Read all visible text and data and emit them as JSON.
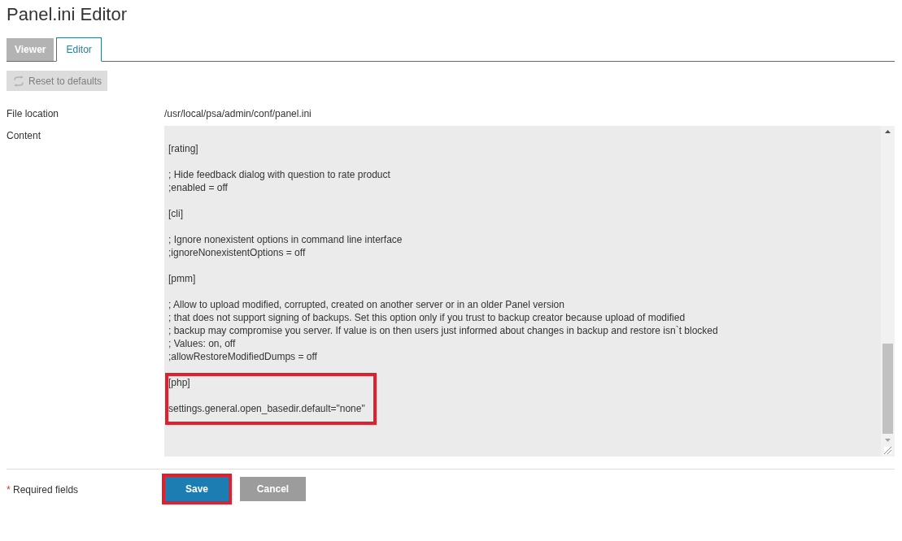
{
  "page": {
    "title": "Panel.ini Editor"
  },
  "tabs": [
    {
      "label": "Viewer",
      "selected": false
    },
    {
      "label": "Editor",
      "selected": true
    }
  ],
  "toolbar": {
    "buttons": [
      {
        "label": "Reset to defaults",
        "disabled": true
      }
    ]
  },
  "form": {
    "fields": [
      {
        "kind": "text",
        "label": "File location",
        "value": "/usr/local/psa/admin/conf/panel.ini"
      },
      {
        "kind": "textarea",
        "label": "Content",
        "groups": [
          {
            "highlighted": false,
            "blocks": [
              [
                "[rating]"
              ],
              [
                "; Hide feedback dialog with question to rate product",
                ";enabled = off"
              ],
              [
                "[cli]"
              ],
              [
                "; Ignore nonexistent options in command line interface",
                ";ignoreNonexistentOptions = off"
              ],
              [
                "[pmm]"
              ],
              [
                "; Allow to upload modified, corrupted, created on another server or in an older Panel version",
                "; that does not support signing of backups. Set this option only if you trust to backup creator because upload of modified",
                "; backup may compromise you server. If value is on then users just informed about changes in backup and restore isn`t blocked",
                "; Values: on, off",
                ";allowRestoreModifiedDumps = off"
              ]
            ]
          },
          {
            "highlighted": true,
            "blocks": [
              [
                "[php]"
              ],
              [
                "settings.general.open_basedir.default=\"none\""
              ]
            ]
          }
        ]
      }
    ]
  },
  "footer": {
    "required_note": {
      "mark": "*",
      "text": "Required fields"
    },
    "buttons": [
      {
        "kind": "primary",
        "label": "Save",
        "highlighted": true
      },
      {
        "kind": "secondary",
        "label": "Cancel",
        "highlighted": false
      }
    ]
  }
}
